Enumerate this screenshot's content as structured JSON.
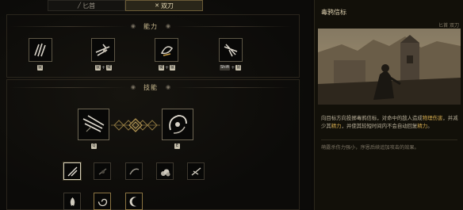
{
  "weapon_tabs": [
    {
      "label": "匕首",
      "icon": "dagger-icon",
      "active": false
    },
    {
      "label": "双刀",
      "icon": "crossed-blades-icon",
      "active": true
    }
  ],
  "sections": {
    "abilities": {
      "title": "能力"
    },
    "skills": {
      "title": "技能"
    }
  },
  "abilities": [
    {
      "icon": "triple-claw-icon",
      "keys": [
        "鼠"
      ]
    },
    {
      "icon": "dash-slash-icon",
      "keys": [
        "鼠",
        "键"
      ]
    },
    {
      "icon": "whirl-leap-icon",
      "keys": [
        "键",
        "鼠"
      ]
    },
    {
      "icon": "dive-strike-icon",
      "keys": [
        "Shift",
        "鼠"
      ]
    }
  ],
  "main_skills": [
    {
      "icon": "blade-barrage-icon",
      "key": "Q"
    },
    {
      "icon": "spin-slash-icon",
      "key": "E"
    }
  ],
  "skill_row_1": [
    {
      "icon": "thrown-blade-icon",
      "selected": true
    },
    {
      "icon": "shadow-cut-icon",
      "selected": false
    },
    {
      "icon": "arc-slash-icon",
      "selected": false
    },
    {
      "icon": "smoke-burst-icon",
      "selected": false
    },
    {
      "icon": "wing-slash-icon",
      "selected": false
    }
  ],
  "skill_row_2": [
    {
      "icon": "flame-orb-icon"
    },
    {
      "icon": "vortex-icon"
    },
    {
      "icon": "crescent-icon"
    }
  ],
  "detail": {
    "title": "毒鸦信标",
    "subtitle": "匕首 双刀",
    "desc_parts": [
      {
        "text": "向目标方向投掷毒鸦信标，对命中的敌人造成",
        "hl": false
      },
      {
        "text": "物理伤害",
        "hl": true
      },
      {
        "text": "，并减少其",
        "hl": false
      },
      {
        "text": "精力",
        "hl": true
      },
      {
        "text": "，并使其较短时间内不会自动回复",
        "hl": false
      },
      {
        "text": "精力",
        "hl": true
      },
      {
        "text": "。",
        "hl": false
      }
    ],
    "note": "萌露杀伤力强小，序恩后续追加攻击的效果。"
  },
  "colors": {
    "accent_gold": "#c9b98f",
    "highlight": "#d0a84e"
  }
}
